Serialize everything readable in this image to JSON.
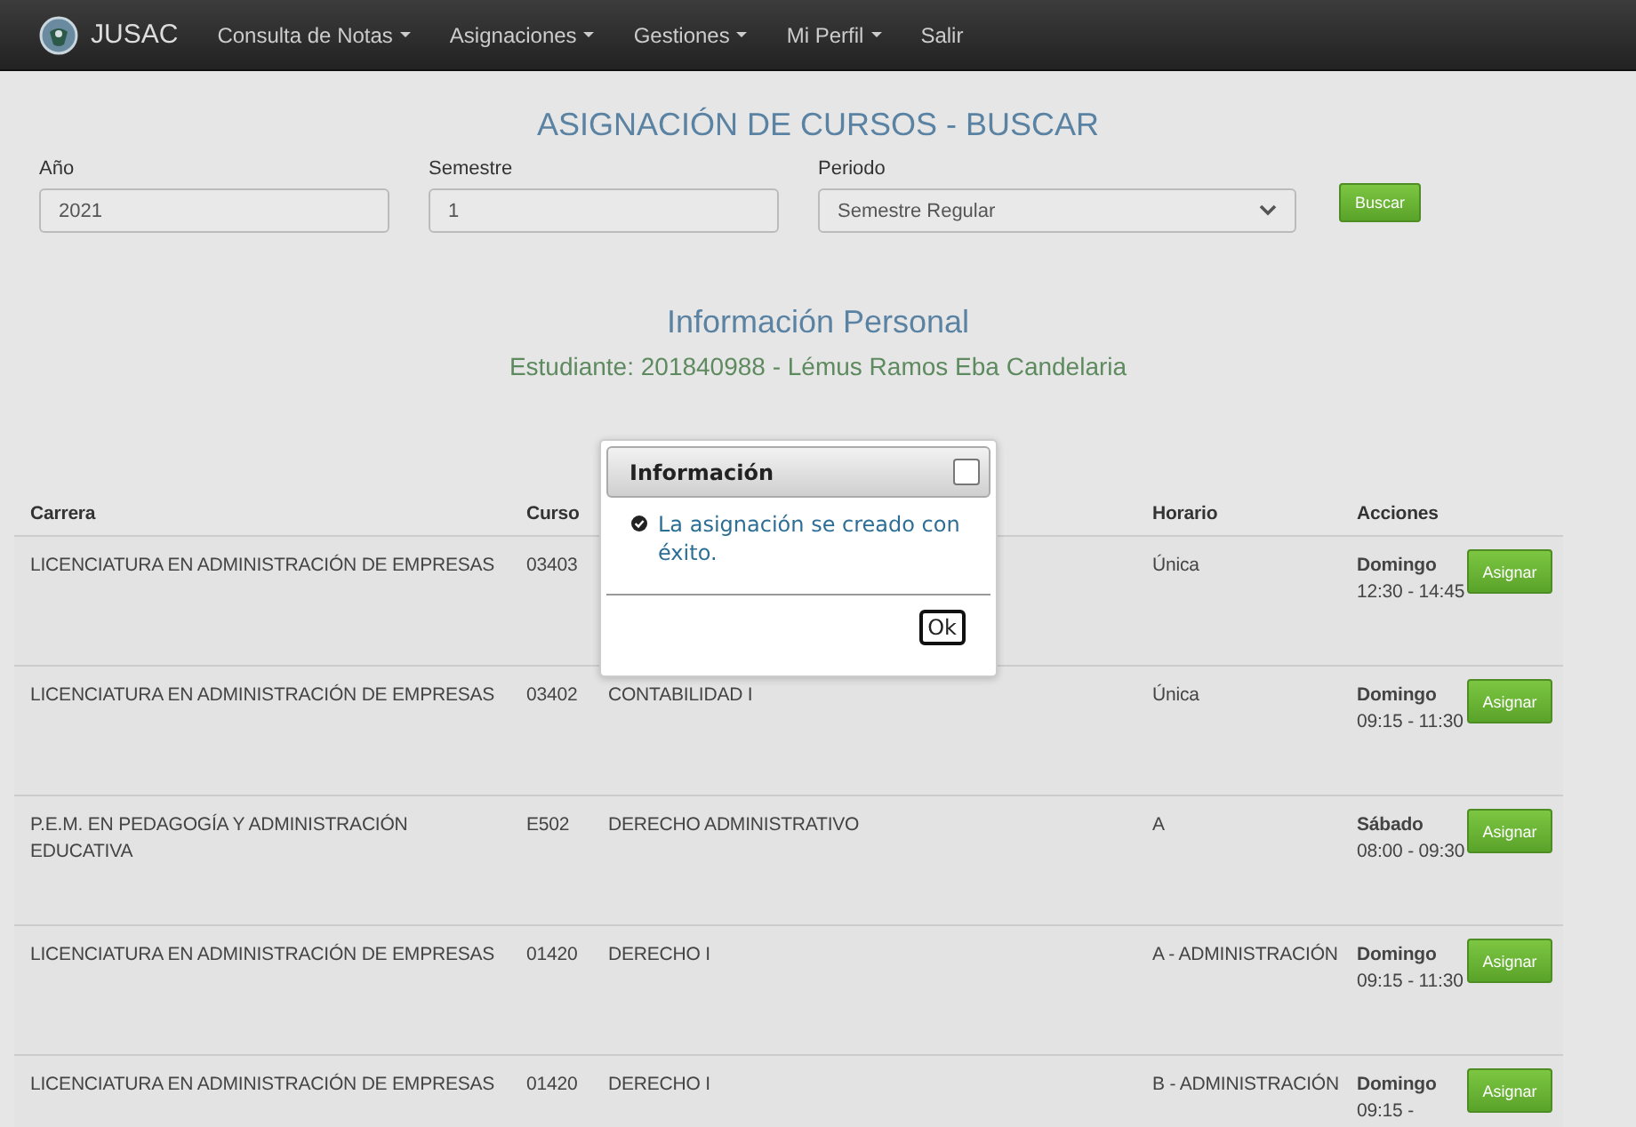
{
  "navbar": {
    "brand": "JUSAC",
    "menu": [
      {
        "label": "Consulta de Notas",
        "dropdown": true
      },
      {
        "label": "Asignaciones",
        "dropdown": true
      },
      {
        "label": "Gestiones",
        "dropdown": true
      },
      {
        "label": "Mi Perfil",
        "dropdown": true
      },
      {
        "label": "Salir",
        "dropdown": false
      }
    ]
  },
  "page_title": "ASIGNACIÓN DE CURSOS - BUSCAR",
  "search": {
    "fields": [
      {
        "kind": "input",
        "label": "Año",
        "value": "2021"
      },
      {
        "kind": "input",
        "label": "Semestre",
        "value": "1"
      },
      {
        "kind": "select",
        "label": "Periodo",
        "value": "Semestre Regular"
      }
    ],
    "button": "Buscar"
  },
  "personal": {
    "heading": "Información Personal",
    "student": "Estudiante: 201840988 - Lémus Ramos Eba Candelaria"
  },
  "table": {
    "columns": [
      "Carrera",
      "Curso",
      "Horario",
      "Acciones"
    ],
    "rows": [
      {
        "carrera": "LICENCIATURA EN ADMINISTRACIÓN DE EMPRESAS",
        "curso": "03403",
        "horario": "Única",
        "dia": "Domingo",
        "hora": "12:30 - 14:45",
        "action": "Asignar"
      },
      {
        "carrera": "LICENCIATURA EN ADMINISTRACIÓN DE EMPRESAS",
        "curso": "03402",
        "nombre": "CONTABILIDAD I",
        "horario": "Única",
        "dia": "Domingo",
        "hora": "09:15 - 11:30",
        "action": "Asignar"
      },
      {
        "carrera": "P.E.M. EN PEDAGOGÍA Y ADMINISTRACIÓN EDUCATIVA",
        "curso": "E502",
        "nombre": "DERECHO ADMINISTRATIVO",
        "horario": "A",
        "dia": "Sábado",
        "hora": "08:00 - 09:30",
        "action": "Asignar"
      },
      {
        "carrera": "LICENCIATURA EN ADMINISTRACIÓN DE EMPRESAS",
        "curso": "01420",
        "nombre": "DERECHO I",
        "horario": "A - ADMINISTRACIÓN",
        "dia": "Domingo",
        "hora": "09:15 - 11:30",
        "action": "Asignar"
      },
      {
        "carrera": "LICENCIATURA EN ADMINISTRACIÓN DE EMPRESAS",
        "curso": "01420",
        "nombre": "DERECHO I",
        "horario": "B - ADMINISTRACIÓN",
        "dia": "Domingo",
        "hora": "09:15 -",
        "action": "Asignar"
      }
    ]
  },
  "dialog": {
    "title": "Información",
    "message": "La asignación se creado con éxito.",
    "button": "Ok"
  }
}
